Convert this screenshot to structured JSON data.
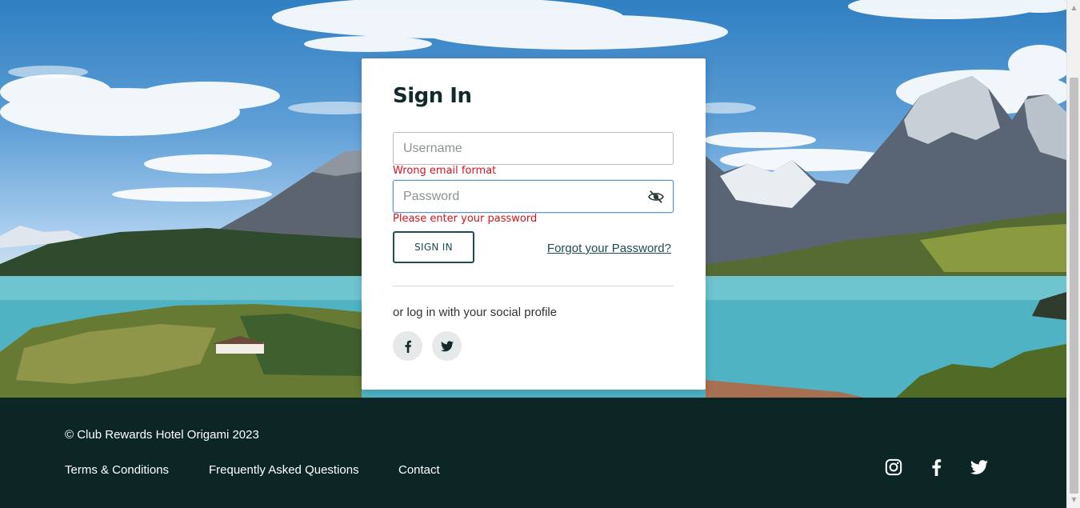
{
  "card": {
    "title": "Sign In",
    "username": {
      "placeholder": "Username",
      "value": "",
      "error": "Wrong email format"
    },
    "password": {
      "placeholder": "Password",
      "value": "",
      "error": "Please enter your password",
      "visibility_icon": "eye-slash-icon"
    },
    "sign_in_label": "SIGN IN",
    "forgot_label": "Forgot your Password?",
    "social_text": "or log in with your social profile",
    "social": [
      {
        "icon": "facebook-icon"
      },
      {
        "icon": "twitter-icon"
      }
    ]
  },
  "footer": {
    "copyright": "© Club Rewards Hotel Origami 2023",
    "links": [
      "Terms & Conditions",
      "Frequently Asked Questions",
      "Contact"
    ],
    "social": [
      "instagram-icon",
      "facebook-icon",
      "twitter-icon"
    ]
  },
  "colors": {
    "primary": "#1e4d52",
    "error": "#d6121c",
    "footer_bg": "#0c2626",
    "focus": "#5f93c9"
  }
}
